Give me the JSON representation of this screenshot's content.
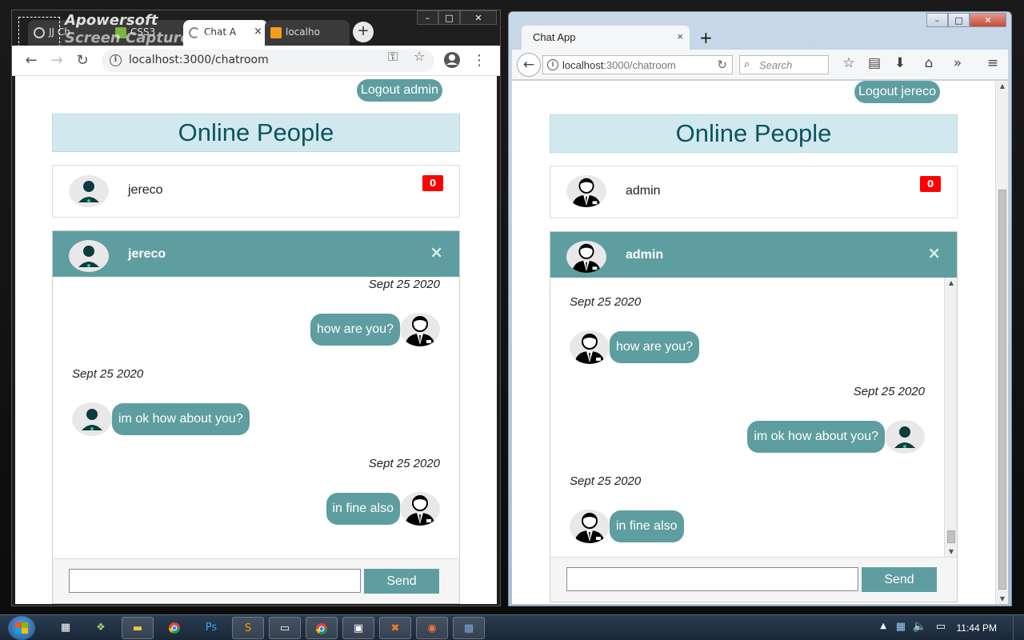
{
  "colors": {
    "teal": "#5f9ea0",
    "header_bg": "#d1e9ee",
    "header_text": "#0c5460",
    "badge": "#ff0000"
  },
  "watermark": {
    "line1": "Apowersoft",
    "line2": "Screen Capture Pro"
  },
  "chrome": {
    "tabs": [
      {
        "label": "JJ Ch",
        "icon": "loading-icon"
      },
      {
        "label": "CSS3",
        "icon": "css-icon"
      },
      {
        "label": "Chat A",
        "icon": "loading-icon",
        "close": "×"
      },
      {
        "label": "localho",
        "icon": "phpmyadmin-icon"
      }
    ],
    "new_tab": "+",
    "url": "localhost:3000/chatroom",
    "window_buttons": [
      "–",
      "□",
      "✕"
    ]
  },
  "left_app": {
    "logout_label": "Logout admin",
    "header": "Online People",
    "contact": {
      "name": "jereco",
      "badge": "0"
    },
    "chat": {
      "title": "jereco",
      "close": "×",
      "messages": [
        {
          "date": "Sept 25 2020",
          "text": "how are you?",
          "side": "right",
          "avatar": "man-in-suit-avatar"
        },
        {
          "date": "Sept 25 2020",
          "text": "im ok how about you?",
          "side": "left",
          "avatar": "user-avatar"
        },
        {
          "date": "Sept 25 2020",
          "text": "in fine also",
          "side": "right",
          "avatar": "man-in-suit-avatar"
        }
      ],
      "send_label": "Send",
      "input_value": ""
    }
  },
  "firefox": {
    "tab_title": "Chat App",
    "tab_close": "×",
    "new_tab": "+",
    "url_host": "localhost",
    "url_rest": ":3000/chatroom",
    "search_placeholder": "Search",
    "window_buttons": [
      "–",
      "□",
      "✕"
    ]
  },
  "right_app": {
    "logout_label": "Logout jereco",
    "header": "Online People",
    "contact": {
      "name": "admin",
      "badge": "0"
    },
    "chat": {
      "title": "admin",
      "close": "×",
      "messages": [
        {
          "date": "Sept 25 2020",
          "text": "how are you?",
          "side": "left",
          "avatar": "man-in-suit-avatar"
        },
        {
          "date": "Sept 25 2020",
          "text": "im ok how about you?",
          "side": "right",
          "avatar": "user-avatar"
        },
        {
          "date": "Sept 25 2020",
          "text": "in fine also",
          "side": "left",
          "avatar": "man-in-suit-avatar"
        }
      ],
      "send_label": "Send",
      "input_value": ""
    }
  },
  "taskbar": {
    "clock": "11:44 PM",
    "apps": [
      "calculator-icon",
      "tree-icon",
      "file-explorer-icon",
      "chrome-icon",
      "photoshop-icon",
      "sublime-icon",
      "window-icon",
      "chrome-icon",
      "cmd-icon",
      "xampp-icon",
      "firefox-icon",
      "app-icon"
    ]
  }
}
